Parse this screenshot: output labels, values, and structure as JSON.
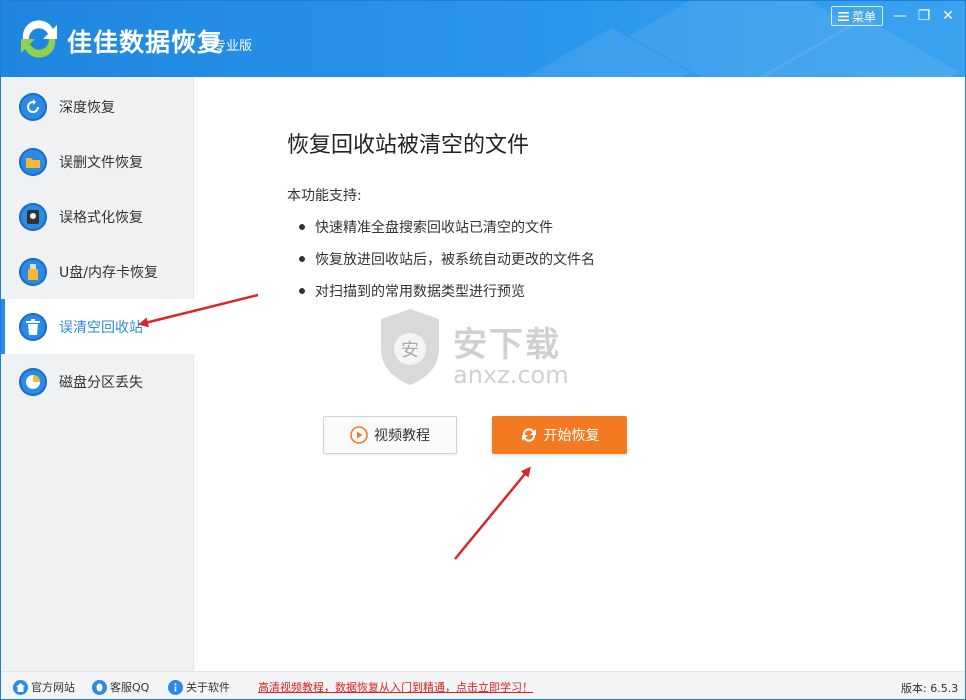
{
  "window": {
    "app_title": "佳佳数据恢复",
    "edition": "专业版",
    "menu_label": "菜单",
    "minimize": "—",
    "restore": "❐",
    "close": "✕"
  },
  "sidebar": {
    "items": [
      {
        "label": "深度恢复",
        "icon": "refresh-icon"
      },
      {
        "label": "误删文件恢复",
        "icon": "folder-icon"
      },
      {
        "label": "误格式化恢复",
        "icon": "disk-icon"
      },
      {
        "label": "U盘/内存卡恢复",
        "icon": "usb-icon"
      },
      {
        "label": "误清空回收站",
        "icon": "recycle-bin-icon",
        "active": true
      },
      {
        "label": "磁盘分区丢失",
        "icon": "pie-icon"
      }
    ]
  },
  "main": {
    "title": "恢复回收站被清空的文件",
    "support_label": "本功能支持:",
    "features": [
      "快速精准全盘搜索回收站已清空的文件",
      "恢复放进回收站后，被系统自动更改的文件名",
      "对扫描到的常用数据类型进行预览"
    ],
    "video_button": "视频教程",
    "start_button": "开始恢复",
    "watermark_cn": "安下载",
    "watermark_en": "anxz.com",
    "watermark_badge": "安"
  },
  "footer": {
    "official_site": "官方网站",
    "support_qq": "客服QQ",
    "about": "关于软件",
    "promo": "高清视频教程，数据恢复从入门到精通，点击立即学习！",
    "version": "版本: 6.5.3"
  },
  "colors": {
    "header": "#1f86e0",
    "accent": "#2b8ae6",
    "start_button": "#f47a22",
    "promo": "#e02020",
    "arrow": "#d9252b"
  }
}
